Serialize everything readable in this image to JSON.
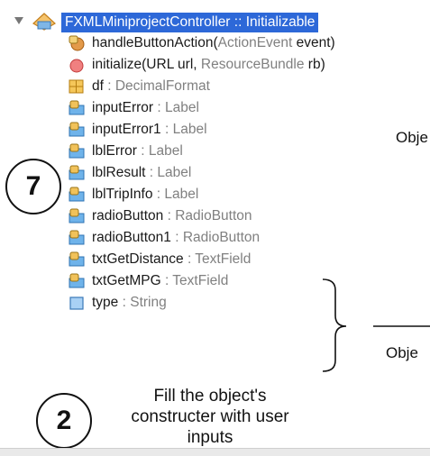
{
  "tree": {
    "root": {
      "label": "FXMLMiniprojectController :: Initializable",
      "icon": "class-icon",
      "expanded": true
    },
    "members": [
      {
        "name": "handleButtonAction",
        "detail_a": "(",
        "detail_type": "ActionEvent",
        "detail_b": " event)",
        "icon": "method-private-icon"
      },
      {
        "name": "initialize",
        "detail_a": "(URL url, ",
        "detail_type": "ResourceBundle",
        "detail_b": " rb)",
        "icon": "method-public-icon"
      },
      {
        "name": "df",
        "sep": " : ",
        "type": "DecimalFormat",
        "icon": "field-static-icon"
      },
      {
        "name": "inputError",
        "sep": " : ",
        "type": "Label",
        "icon": "field-private-icon"
      },
      {
        "name": "inputError1",
        "sep": " : ",
        "type": "Label",
        "icon": "field-private-icon"
      },
      {
        "name": "lblError",
        "sep": " : ",
        "type": "Label",
        "icon": "field-private-icon"
      },
      {
        "name": "lblResult",
        "sep": " : ",
        "type": "Label",
        "icon": "field-private-icon"
      },
      {
        "name": "lblTripInfo",
        "sep": " : ",
        "type": "Label",
        "icon": "field-private-icon"
      },
      {
        "name": "radioButton",
        "sep": " : ",
        "type": "RadioButton",
        "icon": "field-private-icon"
      },
      {
        "name": "radioButton1",
        "sep": " : ",
        "type": "RadioButton",
        "icon": "field-private-icon"
      },
      {
        "name": "txtGetDistance",
        "sep": " : ",
        "type": "TextField",
        "icon": "field-private-icon"
      },
      {
        "name": "txtGetMPG",
        "sep": " : ",
        "type": "TextField",
        "icon": "field-private-icon"
      },
      {
        "name": "type",
        "sep": " : ",
        "type": "String",
        "icon": "field-package-icon"
      }
    ]
  },
  "annotations": {
    "callout_top": "Obje",
    "callout_bottom": "Obje",
    "step_7": "7",
    "step_2": "2",
    "note": "Fill the object's constructer with user inputs"
  },
  "colors": {
    "selection": "#2d68d8",
    "type_gray": "#808080",
    "method_private": "#e39a4a",
    "method_public": "#e85b5b",
    "field_orange": "#e8a53a",
    "field_blue": "#4aa3e8"
  }
}
